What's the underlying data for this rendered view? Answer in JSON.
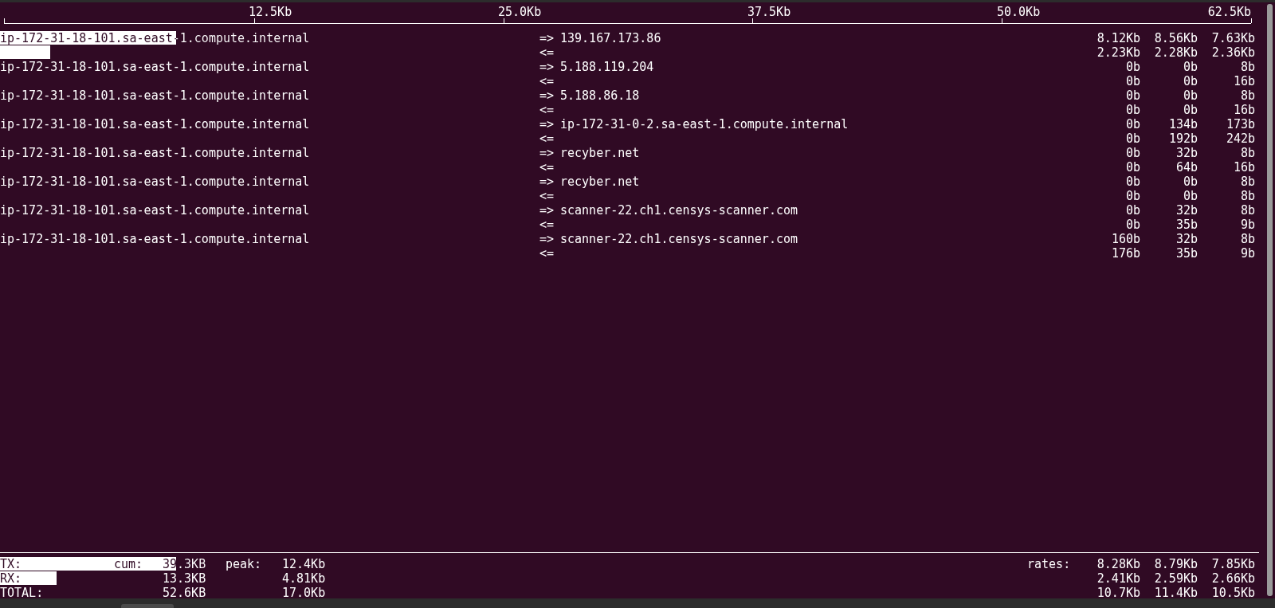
{
  "scale": {
    "ticks": [
      "12.5Kb",
      "25.0Kb",
      "37.5Kb",
      "50.0Kb",
      "62.5Kb"
    ]
  },
  "connections": [
    {
      "source": "ip-172-31-18-101.sa-east-1.compute.internal",
      "lines": [
        {
          "direction": "=>",
          "host": "139.167.173.86",
          "rates": [
            "8.12Kb",
            "8.56Kb",
            "7.63Kb"
          ],
          "level": 0.14
        },
        {
          "direction": "<=",
          "rates": [
            "2.23Kb",
            "2.28Kb",
            "2.36Kb"
          ],
          "level": 0.04
        }
      ]
    },
    {
      "source": "ip-172-31-18-101.sa-east-1.compute.internal",
      "lines": [
        {
          "direction": "=>",
          "host": "5.188.119.204",
          "rates": [
            "0b",
            "0b",
            "8b"
          ]
        },
        {
          "direction": "<=",
          "rates": [
            "0b",
            "0b",
            "16b"
          ]
        }
      ]
    },
    {
      "source": "ip-172-31-18-101.sa-east-1.compute.internal",
      "lines": [
        {
          "direction": "=>",
          "host": "5.188.86.18",
          "rates": [
            "0b",
            "0b",
            "8b"
          ]
        },
        {
          "direction": "<=",
          "rates": [
            "0b",
            "0b",
            "16b"
          ]
        }
      ]
    },
    {
      "source": "ip-172-31-18-101.sa-east-1.compute.internal",
      "lines": [
        {
          "direction": "=>",
          "host": "ip-172-31-0-2.sa-east-1.compute.internal",
          "rates": [
            "0b",
            "134b",
            "173b"
          ]
        },
        {
          "direction": "<=",
          "rates": [
            "0b",
            "192b",
            "242b"
          ]
        }
      ]
    },
    {
      "source": "ip-172-31-18-101.sa-east-1.compute.internal",
      "lines": [
        {
          "direction": "=>",
          "host": "recyber.net",
          "rates": [
            "0b",
            "32b",
            "8b"
          ]
        },
        {
          "direction": "<=",
          "rates": [
            "0b",
            "64b",
            "16b"
          ]
        }
      ]
    },
    {
      "source": "ip-172-31-18-101.sa-east-1.compute.internal",
      "lines": [
        {
          "direction": "=>",
          "host": "recyber.net",
          "rates": [
            "0b",
            "0b",
            "8b"
          ]
        },
        {
          "direction": "<=",
          "rates": [
            "0b",
            "0b",
            "8b"
          ]
        }
      ]
    },
    {
      "source": "ip-172-31-18-101.sa-east-1.compute.internal",
      "lines": [
        {
          "direction": "=>",
          "host": "scanner-22.ch1.censys-scanner.com",
          "rates": [
            "0b",
            "32b",
            "8b"
          ]
        },
        {
          "direction": "<=",
          "rates": [
            "0b",
            "35b",
            "9b"
          ]
        }
      ]
    },
    {
      "source": "ip-172-31-18-101.sa-east-1.compute.internal",
      "lines": [
        {
          "direction": "=>",
          "host": "scanner-22.ch1.censys-scanner.com",
          "rates": [
            "160b",
            "32b",
            "8b"
          ]
        },
        {
          "direction": "<=",
          "rates": [
            "176b",
            "35b",
            "9b"
          ]
        }
      ]
    }
  ],
  "totals": [
    {
      "label": "TX:",
      "cum_label": "cum:",
      "cum": "39.3KB",
      "peak_label": "peak:",
      "peak": "12.4Kb",
      "rates_label": "rates:",
      "rates": [
        "8.28Kb",
        "8.79Kb",
        "7.85Kb"
      ],
      "level": 0.14
    },
    {
      "label": "RX:",
      "cum": "13.3KB",
      "peak": "4.81Kb",
      "rates": [
        "2.41Kb",
        "2.59Kb",
        "2.66Kb"
      ],
      "level": 0.045
    },
    {
      "label": "TOTAL:",
      "cum": "52.6KB",
      "peak": "17.0Kb",
      "rates": [
        "10.7Kb",
        "11.4Kb",
        "10.5Kb"
      ]
    }
  ]
}
